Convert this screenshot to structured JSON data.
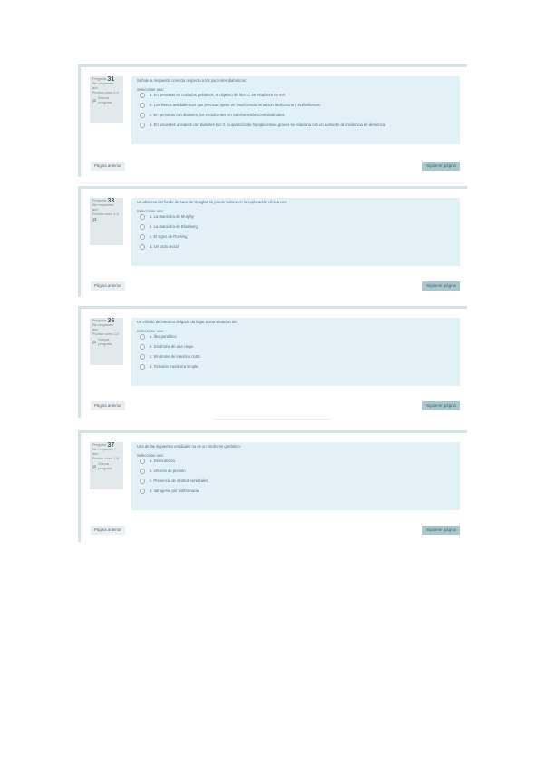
{
  "common": {
    "question_prefix": "Pregunta",
    "unanswered": "Sin responder aún",
    "score": "Puntúa como 1,0",
    "flag_label": "Marcar pregunta",
    "select_one": "Seleccione una:",
    "prev_label": "Página anterior",
    "next_label": "Siguiente página"
  },
  "questions": [
    {
      "number": "31",
      "text": "Señale la respuesta correcta respecto a los pacientes diabéticos:",
      "options": [
        "a. En personas en cuidados paliativos, el objetivo de hbA1C se establece en 8%.",
        "b. Los iseecs antidiabeticos que precisan ajuste en insuficiencia renal son Metformina y Sulfonilureas.",
        "c. En personas con diabetes, los endulzantes sin calorías están contraindicados.",
        "d. En pacientes ancianos con diabetes tipo 2, la aparición de hipoglucemias graves se relaciona con un aumento de incidencia de demencia"
      ]
    },
    {
      "number": "33",
      "text": "Un absceso del fondo de saco de Douglas se puede valorar en la exploración clínica con:",
      "options": [
        "a. La maniobra de Murphy",
        "b. La maniobra de Blumberg",
        "c. El signo de Rovsing",
        "d. Un tacto rectal"
      ]
    },
    {
      "number": "36",
      "text": "Un vólvulo de intestino delgado da lugar a una situación de:",
      "options": [
        "a. Íleo paralítico",
        "b. Síndrome de asa ciega",
        "c. Síndrome de intestino corto",
        "d. Oclusión mecánica simple"
      ]
    },
    {
      "number": "37",
      "text": "Una de las siguientes entidades no es un síndrome geriátrico:",
      "options": [
        "a. Desnutrición",
        "b. Úlceras de presión",
        "c. Presencia de infartos cerebrales",
        "d. Iatrogenia por polifarmacia"
      ]
    }
  ],
  "colors": {
    "content_bg": "#e1f1f6",
    "info_bg": "#e3e8eb",
    "next_button": "#a9c8cc",
    "prev_button": "#eceff1",
    "card_border": "#d6e3e6"
  }
}
